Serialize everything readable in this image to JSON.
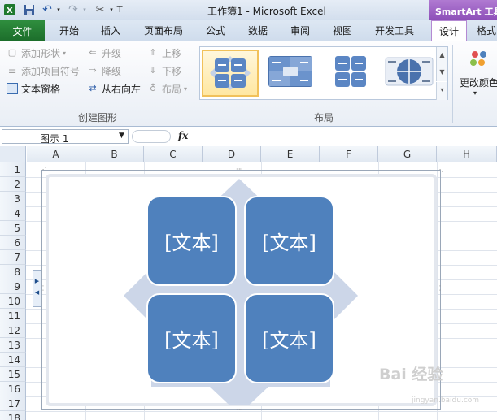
{
  "window": {
    "title": "工作簿1 - Microsoft Excel",
    "context_tab_header": "SmartArt 工具"
  },
  "tabs": {
    "file": "文件",
    "items": [
      "开始",
      "插入",
      "页面布局",
      "公式",
      "数据",
      "审阅",
      "视图",
      "开发工具"
    ],
    "design": "设计",
    "format": "格式"
  },
  "ribbon": {
    "create_graphic": {
      "add_shape": "添加形状",
      "add_bullet": "添加项目符号",
      "text_pane": "文本窗格",
      "promote": "升级",
      "demote": "降级",
      "right_to_left": "从右向左",
      "move_up": "上移",
      "move_down": "下移",
      "layout": "布局",
      "label": "创建图形"
    },
    "layouts": {
      "label": "布局"
    },
    "change_colors": "更改颜色"
  },
  "formula_bar": {
    "name_box": "图示 1",
    "fx": "fx",
    "formula": ""
  },
  "grid": {
    "columns": [
      "A",
      "B",
      "C",
      "D",
      "E",
      "F",
      "G",
      "H"
    ],
    "rows": [
      "1",
      "2",
      "3",
      "4",
      "5",
      "6",
      "7",
      "8",
      "9",
      "10",
      "11",
      "12",
      "13",
      "14",
      "15",
      "16",
      "17",
      "18"
    ]
  },
  "smartart": {
    "boxes": [
      "[文本]",
      "[文本]",
      "[文本]",
      "[文本]"
    ],
    "colors": {
      "box": "#4f81bd",
      "arrows": "#ccd6e8"
    }
  },
  "watermark": {
    "main": "Bai 经验",
    "sub": "jingyan.baidu.com"
  }
}
